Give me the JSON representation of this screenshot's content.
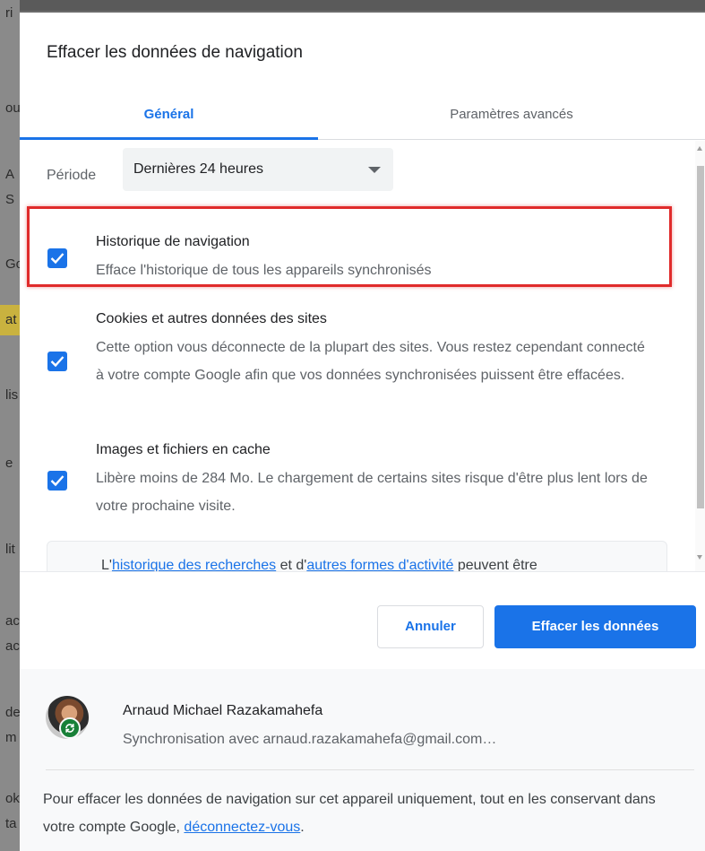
{
  "background_letters": [
    "ri",
    "ou",
    "A",
    "S",
    "Go",
    "at",
    "lis",
    "e",
    "lit",
    "ac",
    "ac",
    "de",
    "m",
    "ok",
    "ta"
  ],
  "dialog": {
    "title": "Effacer les données de navigation",
    "tabs": [
      {
        "label": "Général",
        "active": true
      },
      {
        "label": "Paramètres avancés",
        "active": false
      }
    ],
    "period": {
      "label": "Période",
      "selected": "Dernières 24 heures"
    },
    "items": [
      {
        "checked": true,
        "title": "Historique de navigation",
        "description": "Efface l'historique de tous les appareils synchronisés"
      },
      {
        "checked": true,
        "title": "Cookies et autres données des sites",
        "description": "Cette option vous déconnecte de la plupart des sites. Vous restez cependant connecté à votre compte Google afin que vos données synchronisées puissent être effacées."
      },
      {
        "checked": true,
        "title": "Images et fichiers en cache",
        "description": "Libère moins de 284 Mo. Le chargement de certains sites risque d'être plus lent lors de votre prochaine visite."
      }
    ],
    "info": {
      "prefix": "L'",
      "link1": "historique des recherches",
      "middle": " et d'",
      "link2": "autres formes d'activité",
      "suffix": " peuvent être"
    },
    "buttons": {
      "cancel": "Annuler",
      "clear": "Effacer les données"
    },
    "account": {
      "name": "Arnaud Michael Razakamahefa",
      "sync": "Synchronisation avec arnaud.razakamahefa@gmail.com…"
    },
    "footer_note": {
      "text": "Pour effacer les données de navigation sur cet appareil uniquement, tout en les conservant dans votre compte Google, ",
      "link": "déconnectez-vous",
      "end": "."
    }
  },
  "colors": {
    "accent": "#1a73e8",
    "highlight": "#e02b2b",
    "sync_badge": "#188038"
  }
}
